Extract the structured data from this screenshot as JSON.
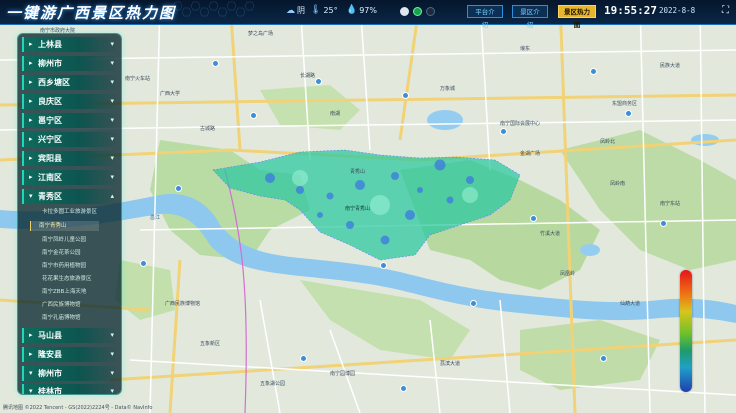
{
  "header": {
    "title": "一键游广西景区热力图",
    "weather": {
      "condition": "阴",
      "temperature": "25°",
      "humidity": "97%"
    },
    "nav": [
      {
        "label": "平台介绍",
        "active": false
      },
      {
        "label": "景区介绍",
        "active": false
      },
      {
        "label": "景区热力图",
        "active": true
      }
    ],
    "time": "19:55:27",
    "date": "2022-8-8"
  },
  "sidebar": {
    "items": [
      {
        "label": "上林县"
      },
      {
        "label": "柳州市"
      },
      {
        "label": "西乡塘区"
      },
      {
        "label": "良庆区"
      },
      {
        "label": "邕宁区"
      },
      {
        "label": "兴宁区"
      },
      {
        "label": "宾阳县"
      },
      {
        "label": "江南区"
      },
      {
        "label": "青秀区"
      }
    ],
    "subitems": [
      "卡拉多圆工业旅游景区",
      "南宁青秀山",
      "南宁凤岭儿童公园",
      "南宁金花茶公园",
      "南宁市药用植物园",
      "花花果生态旅游景区",
      "南宁ZBB上海天地",
      "广西民族博物馆",
      "南宁孔庙博物馆"
    ],
    "more_items": [
      {
        "label": "马山县"
      },
      {
        "label": "隆安县"
      },
      {
        "label": "柳州市"
      },
      {
        "label": "桂林市"
      }
    ]
  },
  "map": {
    "labels": [
      {
        "t": "南宁市政府大院"
      },
      {
        "t": "梦之岛广场"
      },
      {
        "t": "广西大学"
      },
      {
        "t": "万象城"
      },
      {
        "t": "民族大道"
      },
      {
        "t": "青秀山"
      },
      {
        "t": "南宁青秀山"
      },
      {
        "t": "凤岭北"
      },
      {
        "t": "埌东"
      },
      {
        "t": "南湖"
      },
      {
        "t": "五象新区"
      },
      {
        "t": "邕江"
      },
      {
        "t": "南宁国际会展中心"
      },
      {
        "t": "东盟商务区"
      },
      {
        "t": "仙葫大道"
      },
      {
        "t": "广西民族博物馆"
      },
      {
        "t": "五象湖公园"
      },
      {
        "t": "南宁园博园"
      },
      {
        "t": "金湖广场"
      },
      {
        "t": "南宁东站"
      },
      {
        "t": "凤岭南"
      },
      {
        "t": "竹溪大道"
      },
      {
        "t": "古城路"
      },
      {
        "t": "长湖路"
      },
      {
        "t": "南宁火车站"
      },
      {
        "t": "荔滨大道"
      },
      {
        "t": "凤凰岭"
      }
    ]
  },
  "copyright": "腾讯地图 ©2022 Tencent - GS(2022)2224号 - Data© NavInfo",
  "colors": {
    "accent": "#23d6b5",
    "header_bg": "#05162c",
    "active_nav": "#e8b62c"
  }
}
